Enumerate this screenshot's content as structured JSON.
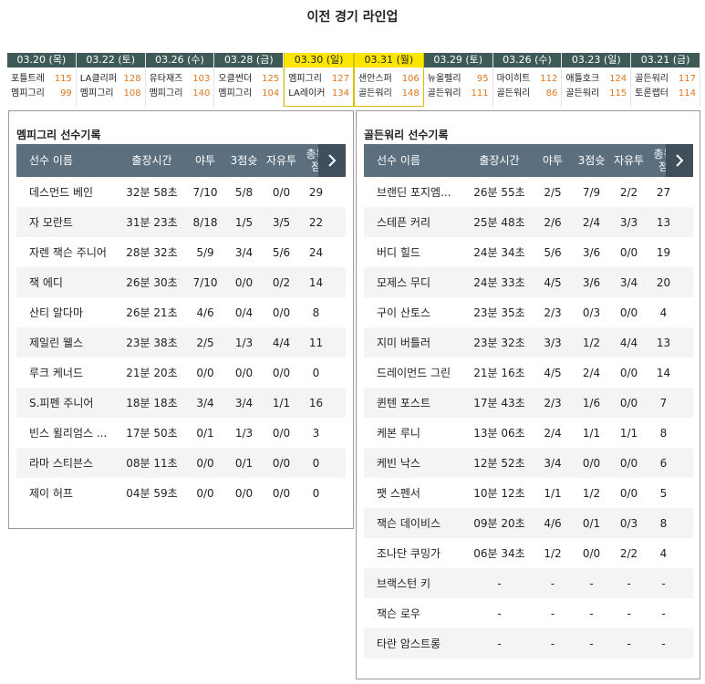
{
  "page_title": "이전 경기 라인업",
  "games": [
    {
      "date": "03.20 (목)",
      "home": "포틀트레",
      "home_score": "115",
      "away": "멤피그리",
      "away_score": "99",
      "selected": false
    },
    {
      "date": "03.22 (토)",
      "home": "LA클리퍼",
      "home_score": "128",
      "away": "멤피그리",
      "away_score": "108",
      "selected": false
    },
    {
      "date": "03.26 (수)",
      "home": "유타재즈",
      "home_score": "103",
      "away": "멤피그리",
      "away_score": "140",
      "selected": false
    },
    {
      "date": "03.28 (금)",
      "home": "오클썬더",
      "home_score": "125",
      "away": "멤피그리",
      "away_score": "104",
      "selected": false
    },
    {
      "date": "03.30 (일)",
      "home": "멤피그리",
      "home_score": "127",
      "away": "LA레이커",
      "away_score": "134",
      "selected": true
    },
    {
      "date": "03.31 (월)",
      "home": "샌안스퍼",
      "home_score": "106",
      "away": "골든워리",
      "away_score": "148",
      "selected": true
    },
    {
      "date": "03.29 (토)",
      "home": "뉴올펠리",
      "home_score": "95",
      "away": "골든워리",
      "away_score": "111",
      "selected": false
    },
    {
      "date": "03.26 (수)",
      "home": "마이히트",
      "home_score": "112",
      "away": "골든워리",
      "away_score": "86",
      "selected": false
    },
    {
      "date": "03.23 (일)",
      "home": "애틀호크",
      "home_score": "124",
      "away": "골든워리",
      "away_score": "115",
      "selected": false
    },
    {
      "date": "03.21 (금)",
      "home": "골든워리",
      "home_score": "117",
      "away": "토론랩터",
      "away_score": "114",
      "selected": false
    }
  ],
  "headers": {
    "name": "선수 이름",
    "minutes": "출장시간",
    "fg": "야투",
    "three": "3점슛",
    "ft": "자유투",
    "pts_1": "총득",
    "pts_2": "점"
  },
  "left": {
    "title": "멤피그리 선수기록",
    "players": [
      {
        "name": "데스먼드 베인",
        "min": "32분 58초",
        "fg": "7/10",
        "three": "5/8",
        "ft": "0/0",
        "pts": "29"
      },
      {
        "name": "자 모란트",
        "min": "31분 23초",
        "fg": "8/18",
        "three": "1/5",
        "ft": "3/5",
        "pts": "22"
      },
      {
        "name": "자렌 잭슨 주니어",
        "min": "28분 32초",
        "fg": "5/9",
        "three": "3/4",
        "ft": "5/6",
        "pts": "24"
      },
      {
        "name": "잭 에디",
        "min": "26분 30초",
        "fg": "7/10",
        "three": "0/0",
        "ft": "0/2",
        "pts": "14"
      },
      {
        "name": "산티 알다마",
        "min": "26분 21초",
        "fg": "4/6",
        "three": "0/4",
        "ft": "0/0",
        "pts": "8"
      },
      {
        "name": "제일린 웰스",
        "min": "23분 38초",
        "fg": "2/5",
        "three": "1/3",
        "ft": "4/4",
        "pts": "11"
      },
      {
        "name": "루크 케너드",
        "min": "21분 20초",
        "fg": "0/0",
        "three": "0/0",
        "ft": "0/0",
        "pts": "0"
      },
      {
        "name": "S.피펜 주니어",
        "min": "18분 18초",
        "fg": "3/4",
        "three": "3/4",
        "ft": "1/1",
        "pts": "16"
      },
      {
        "name": "빈스 윌리엄스 ...",
        "min": "17분 50초",
        "fg": "0/1",
        "three": "1/3",
        "ft": "0/0",
        "pts": "3"
      },
      {
        "name": "라마 스티븐스",
        "min": "08분 11초",
        "fg": "0/0",
        "three": "0/1",
        "ft": "0/0",
        "pts": "0"
      },
      {
        "name": "제이 허프",
        "min": "04분 59초",
        "fg": "0/0",
        "three": "0/0",
        "ft": "0/0",
        "pts": "0"
      }
    ]
  },
  "right": {
    "title": "골든워리 선수기록",
    "players": [
      {
        "name": "브랜딘 포지엠...",
        "min": "26분 55초",
        "fg": "2/5",
        "three": "7/9",
        "ft": "2/2",
        "pts": "27"
      },
      {
        "name": "스테픈 커리",
        "min": "25분 48초",
        "fg": "2/6",
        "three": "2/4",
        "ft": "3/3",
        "pts": "13"
      },
      {
        "name": "버디 힐드",
        "min": "24분 34초",
        "fg": "5/6",
        "three": "3/6",
        "ft": "0/0",
        "pts": "19"
      },
      {
        "name": "모제스 무디",
        "min": "24분 33초",
        "fg": "4/5",
        "three": "3/6",
        "ft": "3/4",
        "pts": "20"
      },
      {
        "name": "구이 산토스",
        "min": "23분 35초",
        "fg": "2/3",
        "three": "0/3",
        "ft": "0/0",
        "pts": "4"
      },
      {
        "name": "지미 버틀러",
        "min": "23분 32초",
        "fg": "3/3",
        "three": "1/2",
        "ft": "4/4",
        "pts": "13"
      },
      {
        "name": "드레이먼드 그린",
        "min": "21분 16초",
        "fg": "4/5",
        "three": "2/4",
        "ft": "0/0",
        "pts": "14"
      },
      {
        "name": "퀸텐 포스트",
        "min": "17분 43초",
        "fg": "2/3",
        "three": "1/6",
        "ft": "0/0",
        "pts": "7"
      },
      {
        "name": "케본 루니",
        "min": "13분 06초",
        "fg": "2/4",
        "three": "1/1",
        "ft": "1/1",
        "pts": "8"
      },
      {
        "name": "케빈 낙스",
        "min": "12분 52초",
        "fg": "3/4",
        "three": "0/0",
        "ft": "0/0",
        "pts": "6"
      },
      {
        "name": "팻 스펜서",
        "min": "10분 12초",
        "fg": "1/1",
        "three": "1/2",
        "ft": "0/0",
        "pts": "5"
      },
      {
        "name": "잭슨 데이비스",
        "min": "09분 20초",
        "fg": "4/6",
        "three": "0/1",
        "ft": "0/3",
        "pts": "8"
      },
      {
        "name": "조나단 쿠밍가",
        "min": "06분 34초",
        "fg": "1/2",
        "three": "0/0",
        "ft": "2/2",
        "pts": "4"
      },
      {
        "name": "브랙스턴 키",
        "min": "-",
        "fg": "-",
        "three": "-",
        "ft": "-",
        "pts": "-"
      },
      {
        "name": "잭슨 로우",
        "min": "-",
        "fg": "-",
        "three": "-",
        "ft": "-",
        "pts": "-"
      },
      {
        "name": "타란 암스트롱",
        "min": "-",
        "fg": "-",
        "three": "-",
        "ft": "-",
        "pts": "-"
      }
    ]
  },
  "icons": {
    "scroll": "chevron-right-icon"
  }
}
